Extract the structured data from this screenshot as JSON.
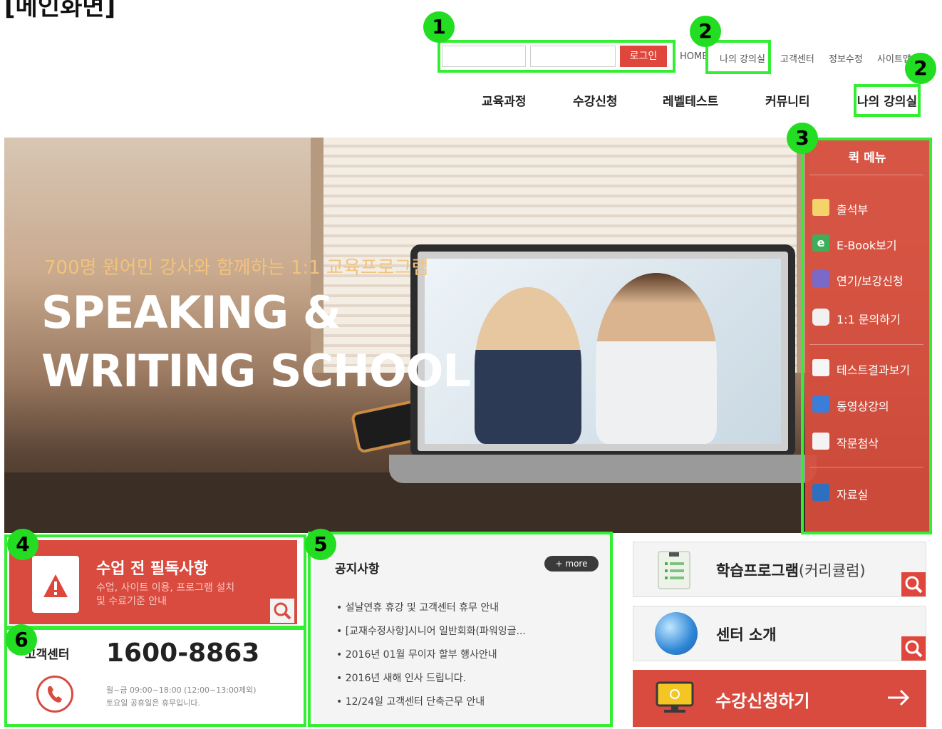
{
  "caption": "[메인화면]",
  "badges": [
    "1",
    "2",
    "2",
    "3",
    "4",
    "5",
    "6"
  ],
  "header": {
    "login_button": "로그인",
    "util_links": [
      "HOME",
      "나의 강의실",
      "고객센터",
      "정보수정",
      "사이트맵"
    ],
    "gnb": [
      "교육과정",
      "수강신청",
      "레벨테스트",
      "커뮤니티",
      "나의 강의실"
    ]
  },
  "hero": {
    "subtitle": "700명 원어민 강사와 함께하는 1:1 교육프로그램",
    "title_line1": "SPEAKING &",
    "title_line2": "WRITING SCHOOL"
  },
  "quick_menu": {
    "title": "퀵 메뉴",
    "items": [
      {
        "label": "출석부",
        "icon": "calendar-icon"
      },
      {
        "label": "E-Book보기",
        "icon": "ebook-icon"
      },
      {
        "label": "연기/보강신청",
        "icon": "calendar-clock-icon"
      },
      {
        "label": "1:1 문의하기",
        "icon": "chat-icon"
      },
      {
        "label": "테스트결과보기",
        "icon": "test-result-icon"
      },
      {
        "label": "동영상강의",
        "icon": "video-icon"
      },
      {
        "label": "작문첨삭",
        "icon": "writing-icon"
      },
      {
        "label": "자료실",
        "icon": "folder-icon"
      }
    ]
  },
  "must_read": {
    "title": "수업 전 필독사항",
    "desc": "수업, 사이트 이용, 프로그램 설치\n및 수료기준 안내"
  },
  "customer_center": {
    "label": "고객센터",
    "phone": "1600-8863",
    "hours": "월~금 09:00~18:00 (12:00~13:00제외)",
    "weekend": "토요일 공휴일은 휴무입니다."
  },
  "notice": {
    "title": "공지사항",
    "more": "+ more",
    "items": [
      "설날연휴 휴강 및 고객센터 휴무 안내",
      "[교재수정사항]시니어 일반회화(파워잉글...",
      "2016년 01월 무이자 할부 행사안내",
      "2016년 새해 인사 드립니다.",
      "12/24일 고객센터 단축근무 안내"
    ]
  },
  "cards": {
    "program": "학습프로그램",
    "program_suffix": "(커리큘럼)",
    "center": "센터 소개",
    "apply": "수강신청하기"
  },
  "colors": {
    "accent": "#d94b3f",
    "highlight": "#33ee33"
  }
}
